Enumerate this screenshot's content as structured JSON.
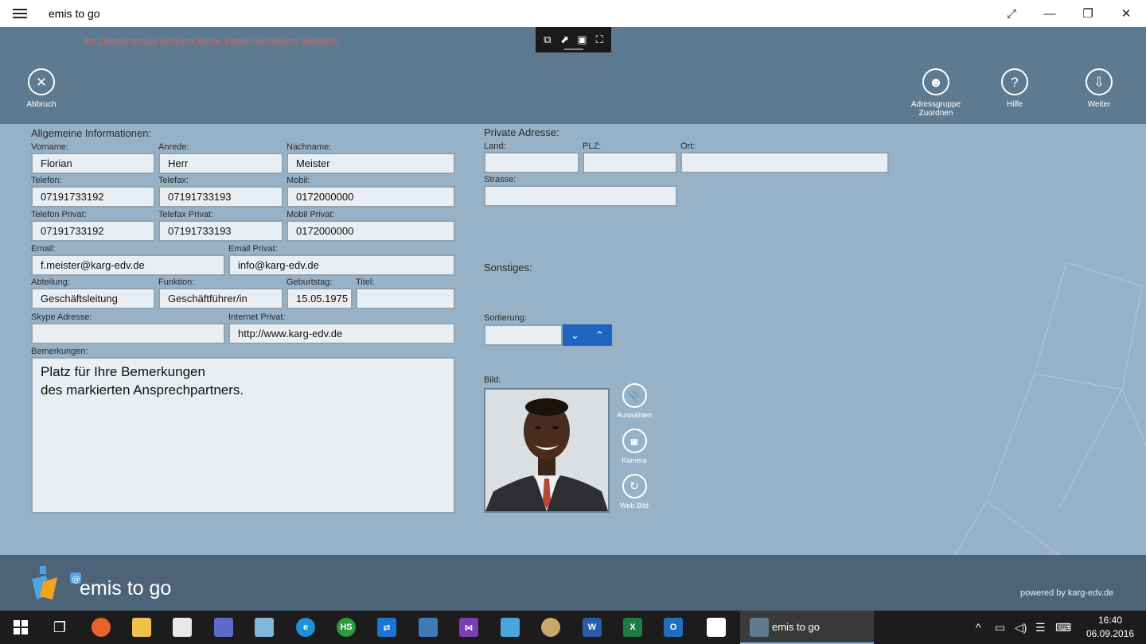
{
  "window": {
    "title": "emis to go",
    "controls": {
      "expand": "⤢",
      "minimize": "—",
      "restore": "❐",
      "close": "✕"
    }
  },
  "header": {
    "demo_notice": "Im Demomodus können keine Daten verändert werden!",
    "buttons": {
      "cancel": "Abbruch",
      "assign_group_line1": "Adressgruppe",
      "assign_group_line2": "Zuordnen",
      "help": "Hilfe",
      "next": "Weiter"
    }
  },
  "general": {
    "section_title": "Allgemeine Informationen:",
    "labels": {
      "vorname": "Vorname:",
      "anrede": "Anrede:",
      "nachname": "Nachname:",
      "telefon": "Telefon:",
      "telefax": "Telefax:",
      "mobil": "Mobil:",
      "telefon_privat": "Telefon Privat:",
      "telefax_privat": "Telefax Privat:",
      "mobil_privat": "Mobil Privat:",
      "email": "Email:",
      "email_privat": "Email Privat:",
      "abteilung": "Abteilung:",
      "funktion": "Funktion:",
      "geburtstag": "Geburtstag:",
      "titel": "Titel:",
      "skype": "Skype Adresse:",
      "internet_privat": "Internet Privat:",
      "bemerkungen": "Bemerkungen:"
    },
    "values": {
      "vorname": "Florian",
      "anrede": "Herr",
      "nachname": "Meister",
      "telefon": "07191733192",
      "telefax": "07191733193",
      "mobil": "0172000000",
      "telefon_privat": "07191733192",
      "telefax_privat": "07191733193",
      "mobil_privat": "0172000000",
      "email": "f.meister@karg-edv.de",
      "email_privat": "info@karg-edv.de",
      "abteilung": "Geschäftsleitung",
      "funktion": "Geschäftführer/in",
      "geburtstag": "15.05.1975",
      "titel": "",
      "skype": "",
      "internet_privat": "http://www.karg-edv.de"
    },
    "remarks": [
      "Platz für Ihre Bemerkungen",
      "des markierten Ansprechpartners."
    ]
  },
  "private_address": {
    "section_title": "Private Adresse:",
    "labels": {
      "land": "Land:",
      "plz": "PLZ:",
      "ort": "Ort:",
      "strasse": "Strasse:"
    },
    "values": {
      "land": "",
      "plz": "",
      "ort": "",
      "strasse": ""
    }
  },
  "misc": {
    "section_title": "Sonstiges:",
    "sort_label": "Sortierung:",
    "sort_value": "",
    "image_label": "Bild:",
    "image_buttons": {
      "select": "Auswählen",
      "camera": "Kamera",
      "web": "Web Bild"
    }
  },
  "footer": {
    "brand": "emis to go",
    "powered": "powered by karg-edv.de"
  },
  "taskbar": {
    "active_task": "emis to go",
    "time": "16:40",
    "date": "06.09.2016"
  },
  "colors": {
    "header_bg": "#5e7a90",
    "content_bg": "#97b2c7",
    "footer_bg": "#4d6478",
    "demo_notice": "#e35d5d",
    "sort_buttons": "#1f64c0"
  }
}
